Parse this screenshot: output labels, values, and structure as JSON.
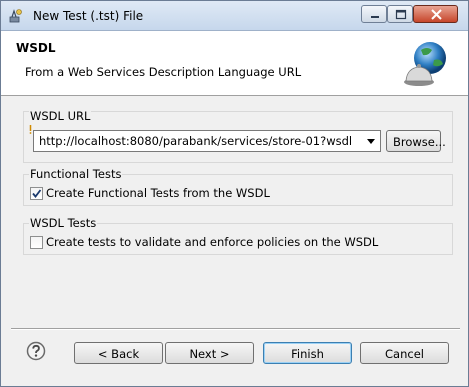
{
  "window": {
    "title": "New Test (.tst) File",
    "title_icon": "wizard-icon",
    "controls": [
      "minimize-icon",
      "maximize-icon",
      "close-icon"
    ]
  },
  "banner": {
    "title": "WSDL",
    "description": "From a Web Services Description Language URL",
    "icon": "globe-service-bell-icon"
  },
  "wsdl_url": {
    "group_label": "WSDL URL",
    "value": "http://localhost:8080/parabank/services/store-01?wsdl",
    "browse_label": "Browse..."
  },
  "functional_tests": {
    "group_label": "Functional Tests",
    "checkbox_label": "Create Functional Tests from the WSDL",
    "checked": true
  },
  "wsdl_tests": {
    "group_label": "WSDL Tests",
    "checkbox_label": "Create tests to validate and enforce policies on the WSDL",
    "checked": false
  },
  "footer": {
    "help_icon": "help-icon",
    "back_label": "< Back",
    "next_label": "Next >",
    "finish_label": "Finish",
    "cancel_label": "Cancel"
  }
}
